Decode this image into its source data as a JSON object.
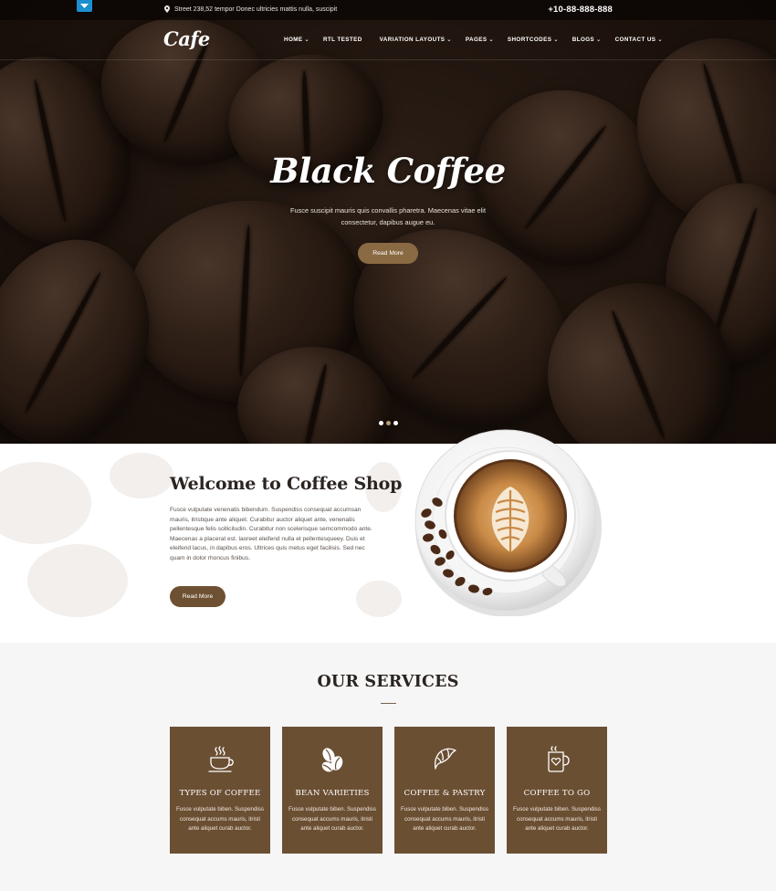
{
  "topbar": {
    "address": "Street 238,52 tempor Donec ultricies mattis nulla, suscipit",
    "phone": "+10-88-888-888"
  },
  "nav": {
    "logo": "Cafe",
    "items": [
      {
        "label": "HOME",
        "dropdown": true
      },
      {
        "label": "RTL TESTED",
        "dropdown": false
      },
      {
        "label": "VARIATION LAYOUTS",
        "dropdown": true
      },
      {
        "label": "PAGES",
        "dropdown": true
      },
      {
        "label": "SHORTCODES",
        "dropdown": true
      },
      {
        "label": "BLOGS",
        "dropdown": true
      },
      {
        "label": "CONTACT US",
        "dropdown": true
      }
    ],
    "chevron": "⌄"
  },
  "hero": {
    "title": "Black Coffee",
    "text": "Fusce suscipit mauris quis convallis pharetra. Maecenas vitae elit consectetur, dapibus augue eu.",
    "button": "Read More",
    "slides": 3,
    "active_slide": 2
  },
  "welcome": {
    "title": "Welcome to Coffee Shop",
    "text": "Fusce vulputate venenatis bibendum. Suspendiss consequat accumsan mauris, itristique ante aliquet. Curabitur auctor aliquet ante, venenatis pellentesque felis sollicitudin. Curabitur non scelerisque semcommodo ante. Maecenas a placerat est. laoreet eleifend nulla et pellentesqueey. Duis et eleifend lacus, in dapibus eros. Ultrices quis metus eget facilisis. Sed nec quam in dolor rhoncus finibus.",
    "button": "Read More"
  },
  "services": {
    "title": "OUR SERVICES",
    "cards": [
      {
        "title": "TYPES OF COFFEE",
        "icon": "coffee-cup-icon",
        "text": "Fusce vulputate biben. Suspendiss consequat accums mauris, itristi ante aliquet curab auctor."
      },
      {
        "title": "BEAN VARIETIES",
        "icon": "coffee-beans-icon",
        "text": "Fusce vulputate biben. Suspendiss consequat accums mauris, itristi ante aliquet curab auctor."
      },
      {
        "title": "COFFEE & PASTRY",
        "icon": "croissant-icon",
        "text": "Fusce vulputate biben. Suspendiss consequat accums mauris, itristi ante aliquet curab auctor."
      },
      {
        "title": "COFFEE TO GO",
        "icon": "coffee-mug-heart-icon",
        "text": "Fusce vulputate biben. Suspendiss consequat accums mauris, itristi ante aliquet curab auctor."
      }
    ]
  },
  "colors": {
    "accent_brown": "#6b4f33",
    "hero_button": "#8a6a43",
    "toggle_blue": "#1d8fd1"
  }
}
